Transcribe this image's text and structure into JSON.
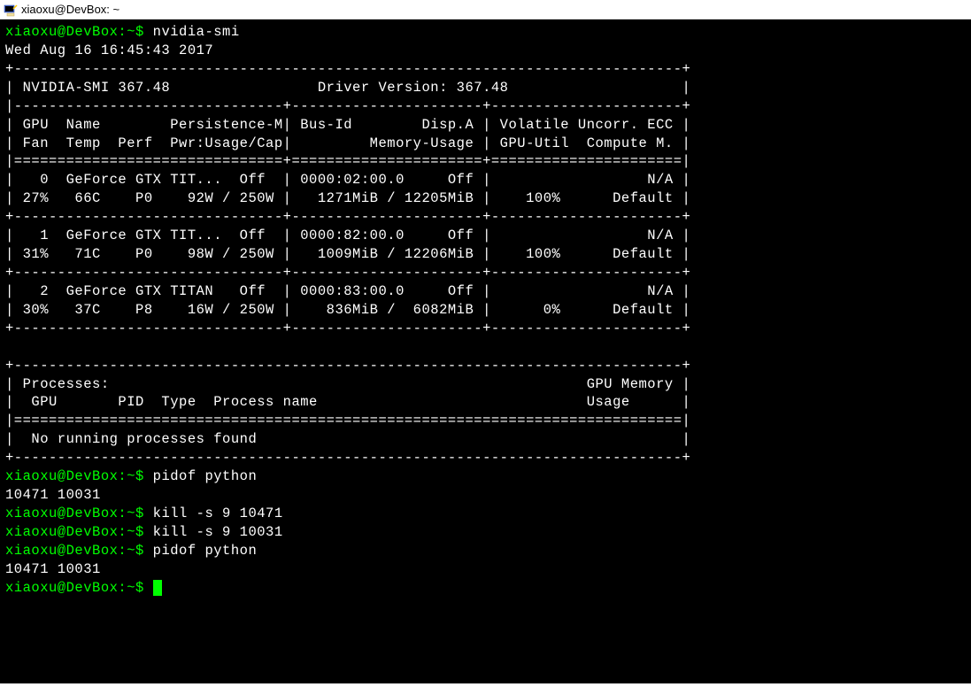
{
  "window": {
    "title": "xiaoxu@DevBox: ~"
  },
  "prompt": "xiaoxu@DevBox:~$ ",
  "commands": {
    "nvidia_smi": "nvidia-smi",
    "pidof_python": "pidof python",
    "kill1": "kill -s 9 10471",
    "kill2": "kill -s 9 10031"
  },
  "pids_output": "10471 10031",
  "nvidia_output": {
    "timestamp": "Wed Aug 16 16:45:43 2017",
    "smi_version": "NVIDIA-SMI 367.48",
    "driver_version": "Driver Version: 367.48",
    "header_row1": "| GPU  Name        Persistence-M| Bus-Id        Disp.A | Volatile Uncorr. ECC |",
    "header_row2": "| Fan  Temp  Perf  Pwr:Usage/Cap|         Memory-Usage | GPU-Util  Compute M. |",
    "gpu0_row1": "|   0  GeForce GTX TIT...  Off  | 0000:02:00.0     Off |                  N/A |",
    "gpu0_row2": "| 27%   66C    P0    92W / 250W |   1271MiB / 12205MiB |    100%      Default |",
    "gpu1_row1": "|   1  GeForce GTX TIT...  Off  | 0000:82:00.0     Off |                  N/A |",
    "gpu1_row2": "| 31%   71C    P0    98W / 250W |   1009MiB / 12206MiB |    100%      Default |",
    "gpu2_row1": "|   2  GeForce GTX TITAN   Off  | 0000:83:00.0     Off |                  N/A |",
    "gpu2_row2": "| 30%   37C    P8    16W / 250W |    836MiB /  6082MiB |      0%      Default |",
    "proc_header": "| Processes:                                                       GPU Memory |",
    "proc_subheader": "|  GPU       PID  Type  Process name                               Usage      |",
    "proc_none": "|  No running processes found                                                 |",
    "sep_top": "+------------------------------------------------------------------------------",
    "sep_header1": "+-----------------------------------------------------------------------------+",
    "sep_version": "| NVIDIA-SMI 367.48                 Driver Version: 367.48                    |",
    "sep_mid": "|-------------------------------+----------------------+----------------------+",
    "sep_eq": "|===============================+======================+======================|",
    "sep_gpu": "+-------------------------------+----------------------+----------------------+",
    "sep_proc_eq": "|=============================================================================|"
  }
}
